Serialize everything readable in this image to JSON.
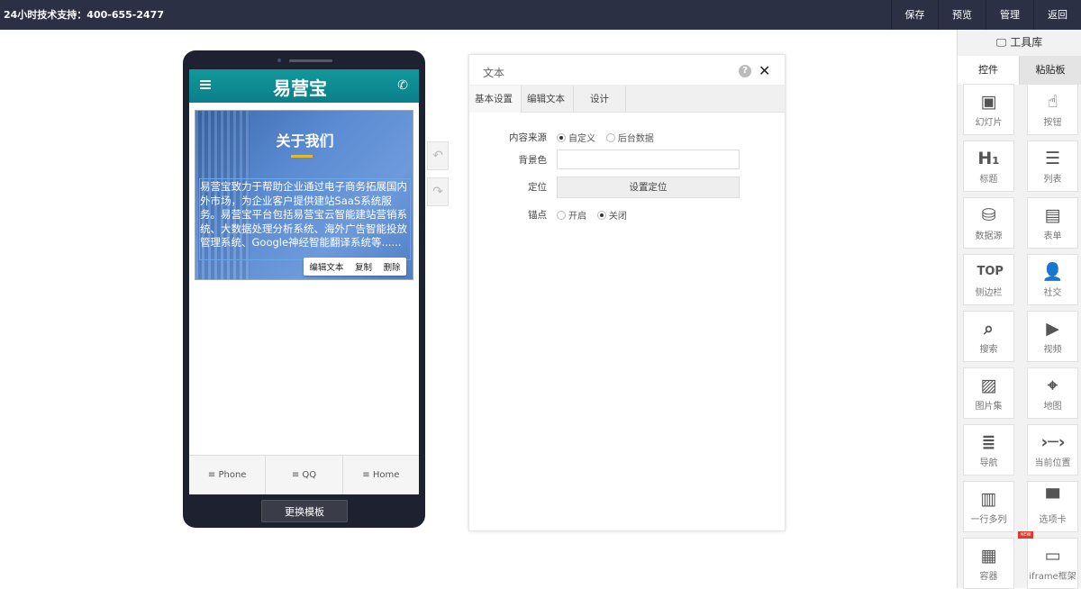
{
  "topbar": {
    "support": "24小时技术支持：400-655-2477",
    "save": "保存",
    "preview": "预览",
    "manage": "管理",
    "back": "返回"
  },
  "phone": {
    "logo": "易营宝",
    "hero_title": "关于我们",
    "hero_text": "易营宝致力于帮助企业通过电子商务拓展国内外市场，为企业客户提供建站SaaS系统服务。易营宝平台包括易营宝云智能建站营销系统、大数据处理分析系统、海外广告智能投放管理系统、Google神经智能翻译系统等......",
    "edit_actions": [
      "编辑文本",
      "复制",
      "删除"
    ],
    "footer": [
      "Phone",
      "QQ",
      "Home"
    ],
    "change_template": "更换模板"
  },
  "panel": {
    "title": "文本",
    "tabs": [
      "基本设置",
      "编辑文本",
      "设计"
    ],
    "content_source_label": "内容来源",
    "content_source_options": [
      "自定义",
      "后台数据"
    ],
    "content_source_selected": "自定义",
    "bg_label": "背景色",
    "position_label": "定位",
    "position_button": "设置定位",
    "anchor_label": "锚点",
    "anchor_options": [
      "开启",
      "关闭"
    ],
    "anchor_selected": "关闭"
  },
  "toolbox": {
    "title": "工具库",
    "tab_controls": "控件",
    "tab_clipboard": "粘贴板",
    "new_badge": "NEW",
    "items": [
      {
        "name": "幻灯片",
        "icon": "slideshow-icon"
      },
      {
        "name": "按钮",
        "icon": "pointer-hand-icon"
      },
      {
        "name": "标题",
        "icon": "heading-icon"
      },
      {
        "name": "列表",
        "icon": "list-icon"
      },
      {
        "name": "数据源",
        "icon": "database-icon"
      },
      {
        "name": "表单",
        "icon": "form-icon"
      },
      {
        "name": "侧边栏",
        "icon": "top-icon"
      },
      {
        "name": "社交",
        "icon": "add-user-icon"
      },
      {
        "name": "搜索",
        "icon": "search-icon"
      },
      {
        "name": "视频",
        "icon": "video-icon"
      },
      {
        "name": "图片集",
        "icon": "gallery-icon"
      },
      {
        "name": "地图",
        "icon": "map-icon"
      },
      {
        "name": "导航",
        "icon": "nav-list-icon"
      },
      {
        "name": "当前位置",
        "icon": "breadcrumb-icon"
      },
      {
        "name": "一行多列",
        "icon": "columns-icon"
      },
      {
        "name": "选项卡",
        "icon": "tabs-icon"
      },
      {
        "name": "容器",
        "icon": "container-icon"
      },
      {
        "name": "iframe框架",
        "icon": "iframe-icon"
      }
    ]
  }
}
